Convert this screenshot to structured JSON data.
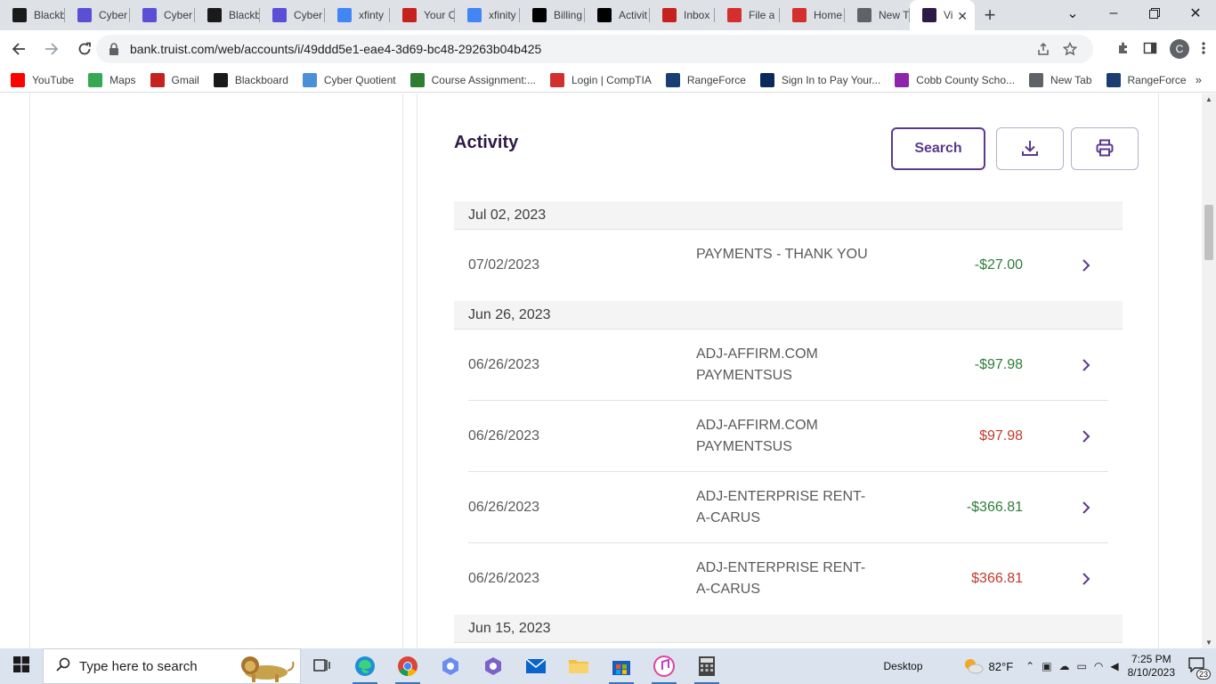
{
  "browser": {
    "tabs": [
      {
        "title": "Blackb",
        "icon": "blackboard-icon",
        "color": "#1a1a1a"
      },
      {
        "title": "Cyber",
        "icon": "cyber-quotient-icon",
        "color": "#5b4fd6"
      },
      {
        "title": "Cyber",
        "icon": "cyber-quotient-icon",
        "color": "#5b4fd6"
      },
      {
        "title": "Blackb",
        "icon": "blackboard-icon",
        "color": "#1a1a1a"
      },
      {
        "title": "Cyber",
        "icon": "cyber-quotient-icon",
        "color": "#5b4fd6"
      },
      {
        "title": "xfinty",
        "icon": "google-icon",
        "color": "#4285f4"
      },
      {
        "title": "Your C",
        "icon": "gmail-icon",
        "color": "#c5221f"
      },
      {
        "title": "xfinity",
        "icon": "google-icon",
        "color": "#4285f4"
      },
      {
        "title": "Billing",
        "icon": "x-icon",
        "color": "#000000"
      },
      {
        "title": "Activit",
        "icon": "x-icon",
        "color": "#000000"
      },
      {
        "title": "Inbox",
        "icon": "gmail-icon",
        "color": "#c5221f"
      },
      {
        "title": "File a",
        "icon": "e-icon",
        "color": "#d32f2f"
      },
      {
        "title": "Home",
        "icon": "e-icon",
        "color": "#d32f2f"
      },
      {
        "title": "New T",
        "icon": "chrome-icon",
        "color": "#5f6368"
      },
      {
        "title": "Vi",
        "icon": "truist-icon",
        "color": "#2e1a47",
        "active": true
      }
    ],
    "close_glyph": "✕",
    "new_tab_glyph": "+",
    "url": "bank.truist.com/web/accounts/i/49ddd5e1-eae4-3d69-bc48-29263b04b425",
    "profile_initial": "C",
    "bookmarks": [
      {
        "label": "YouTube",
        "icon": "youtube-icon",
        "color": "#ff0000"
      },
      {
        "label": "Maps",
        "icon": "maps-icon",
        "color": "#34a853"
      },
      {
        "label": "Gmail",
        "icon": "gmail-icon",
        "color": "#c5221f"
      },
      {
        "label": "Blackboard",
        "icon": "blackboard-icon",
        "color": "#1a1a1a"
      },
      {
        "label": "Cyber Quotient",
        "icon": "cyber-quotient-icon",
        "color": "#4a90d9"
      },
      {
        "label": "Course Assignment:...",
        "icon": "course-icon",
        "color": "#2e7d32"
      },
      {
        "label": "Login | CompTIA",
        "icon": "comptia-icon",
        "color": "#d32f2f"
      },
      {
        "label": "RangeForce",
        "icon": "rangeforce-icon",
        "color": "#1a3e72"
      },
      {
        "label": "Sign In to Pay Your...",
        "icon": "pay-icon",
        "color": "#0a2a5c"
      },
      {
        "label": "Cobb County Scho...",
        "icon": "cobb-icon",
        "color": "#8e24aa"
      },
      {
        "label": "New Tab",
        "icon": "globe-icon",
        "color": "#5f6368"
      },
      {
        "label": "RangeForce",
        "icon": "rangeforce-icon",
        "color": "#1a3e72"
      }
    ],
    "bookmarks_more": "»"
  },
  "activity": {
    "title": "Activity",
    "search_label": "Search",
    "groups": [
      {
        "date_header": "Jul 02, 2023",
        "transactions": [
          {
            "date": "07/02/2023",
            "description": "PAYMENTS - THANK YOU",
            "amount": "-$27.00",
            "type": "credit"
          }
        ]
      },
      {
        "date_header": "Jun 26, 2023",
        "transactions": [
          {
            "date": "06/26/2023",
            "description": "ADJ-AFFIRM.COM PAYMENTSUS",
            "amount": "-$97.98",
            "type": "credit"
          },
          {
            "date": "06/26/2023",
            "description": "ADJ-AFFIRM.COM PAYMENTSUS",
            "amount": "$97.98",
            "type": "debit"
          },
          {
            "date": "06/26/2023",
            "description": "ADJ-ENTERPRISE RENT-A-CARUS",
            "amount": "-$366.81",
            "type": "credit"
          },
          {
            "date": "06/26/2023",
            "description": "ADJ-ENTERPRISE RENT-A-CARUS",
            "amount": "$366.81",
            "type": "debit"
          }
        ]
      },
      {
        "date_header": "Jun 15, 2023",
        "transactions": []
      }
    ],
    "colors": {
      "credit": "#2e7d3a",
      "debit": "#c0392b",
      "brand": "#5b3a8c"
    }
  },
  "taskbar": {
    "search_placeholder": "Type here to search",
    "desktop_label": "Desktop",
    "temperature": "82°F",
    "time": "7:25 PM",
    "date": "8/10/2023",
    "notification_count": "23",
    "pinned": [
      "task-view-icon",
      "edge-icon",
      "chrome-icon",
      "copilot-icon",
      "teams-icon",
      "mail-icon",
      "file-explorer-icon",
      "store-icon",
      "itunes-icon",
      "calculator-icon"
    ]
  }
}
